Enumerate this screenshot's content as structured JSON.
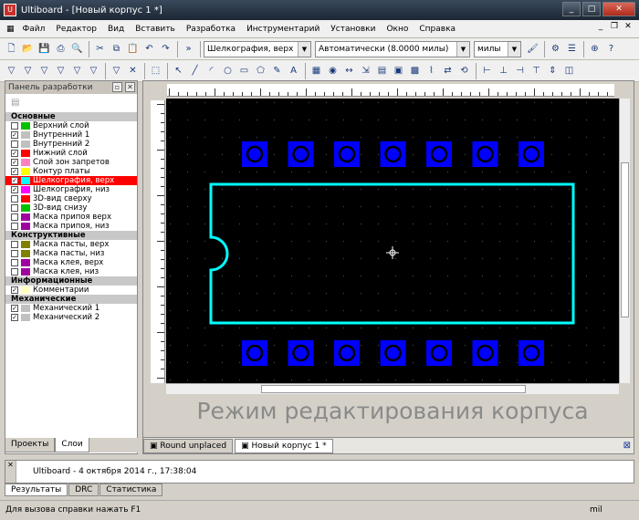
{
  "window": {
    "title": "Ultiboard - [Новый корпус 1 *]",
    "app_icon": "ultiboard-icon"
  },
  "menu": [
    "Файл",
    "Редактор",
    "Вид",
    "Вставить",
    "Разработка",
    "Инструментарий",
    "Установки",
    "Окно",
    "Справка"
  ],
  "toolbar": {
    "layer_combo": "Шелкография, верх",
    "grid_combo": "Автоматически (8.0000 милы)",
    "units_combo": "милы"
  },
  "panel": {
    "title": "Панель разработки",
    "groups": [
      {
        "name": "Основные",
        "layers": [
          {
            "label": "Верхний слой",
            "checked": false,
            "color": "#00c000"
          },
          {
            "label": "Внутренний 1",
            "checked": true,
            "color": "#c0c0c0"
          },
          {
            "label": "Внутренний 2",
            "checked": false,
            "color": "#c0c0c0"
          },
          {
            "label": "Нижний слой",
            "checked": true,
            "color": "#ff0000"
          },
          {
            "label": "Слой зон запретов",
            "checked": true,
            "color": "#ff80c0"
          },
          {
            "label": "Контур платы",
            "checked": true,
            "color": "#ffff00"
          },
          {
            "label": "Шелкография, верх",
            "checked": true,
            "color": "#00ffff",
            "selected": true
          },
          {
            "label": "Шелкография, низ",
            "checked": true,
            "color": "#ff00ff"
          },
          {
            "label": "3D-вид сверху",
            "checked": false,
            "color": "#ff0000"
          },
          {
            "label": "3D-вид снизу",
            "checked": false,
            "color": "#00c000"
          },
          {
            "label": "Маска припоя верх",
            "checked": false,
            "color": "#a000a0"
          },
          {
            "label": "Маска припоя, низ",
            "checked": false,
            "color": "#a000a0"
          }
        ]
      },
      {
        "name": "Конструктивные",
        "layers": [
          {
            "label": "Маска пасты, верх",
            "checked": false,
            "color": "#808000"
          },
          {
            "label": "Маска пасты, низ",
            "checked": false,
            "color": "#808000"
          },
          {
            "label": "Маска клея, верх",
            "checked": false,
            "color": "#a000a0"
          },
          {
            "label": "Маска клея, низ",
            "checked": false,
            "color": "#a000a0"
          }
        ]
      },
      {
        "name": "Информационные",
        "layers": [
          {
            "label": "Комментарии",
            "checked": true,
            "color": "#ffffc0"
          }
        ]
      },
      {
        "name": "Механические",
        "layers": [
          {
            "label": "Механический 1",
            "checked": true,
            "color": "#c0c0c0"
          },
          {
            "label": "Механический 2",
            "checked": true,
            "color": "#c0c0c0"
          }
        ]
      }
    ],
    "tabs": [
      "Проекты",
      "Слои"
    ]
  },
  "canvas": {
    "caption": "Режим редактирования корпуса",
    "pad_count_per_row": 7
  },
  "doc_tabs": [
    "Round unplaced",
    "Новый корпус 1 *"
  ],
  "output": {
    "log": "Ultiboard  -  4 октября 2014 г., 17:38:04",
    "tabs": [
      "Результаты",
      "DRC",
      "Статистика"
    ]
  },
  "status": {
    "help": "Для вызова справки нажать F1",
    "units": "mil"
  },
  "colors": {
    "pad": "#0000ff",
    "outline": "#00ffff",
    "canvas_bg": "#000000"
  }
}
